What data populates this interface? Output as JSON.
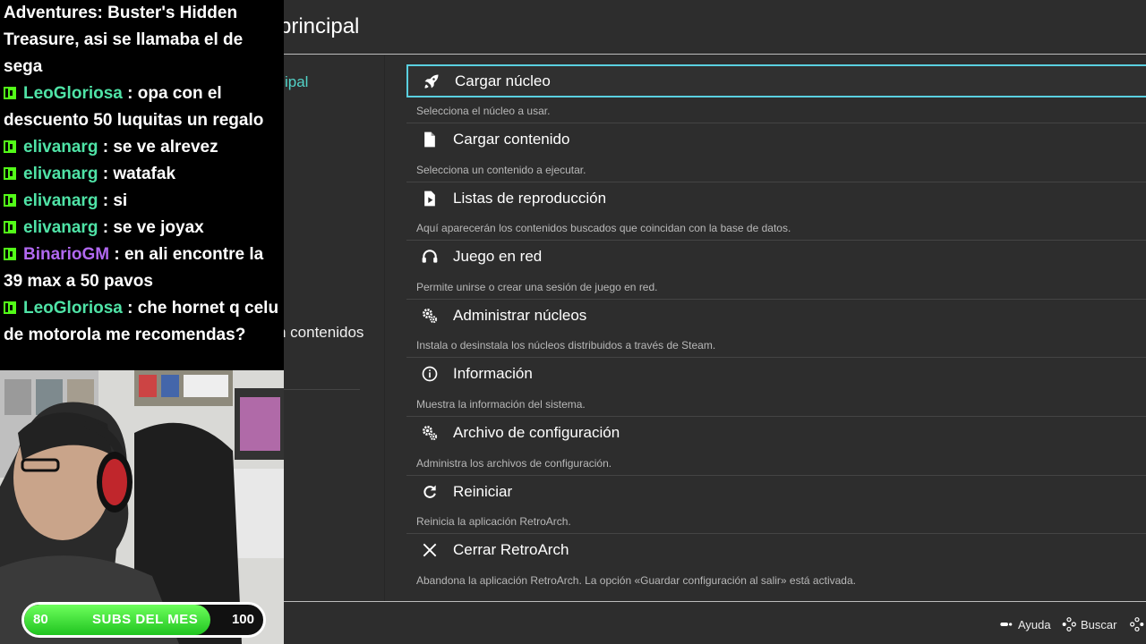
{
  "retroarch": {
    "title": "Menú principal",
    "title_visible": "principal",
    "sidebar": {
      "main_label_visible": "ipal",
      "contents_label_visible": "n contenidos"
    },
    "menu": [
      {
        "label": "Cargar núcleo",
        "sublabel": "Selecciona el núcleo a usar.",
        "icon": "rocket-icon"
      },
      {
        "label": "Cargar contenido",
        "sublabel": "Selecciona un contenido a ejecutar.",
        "icon": "file-icon"
      },
      {
        "label": "Listas de reproducción",
        "sublabel": "Aquí aparecerán los contenidos buscados que coincidan con la base de datos.",
        "icon": "playlist-icon"
      },
      {
        "label": "Juego en red",
        "sublabel": "Permite unirse o crear una sesión de juego en red.",
        "icon": "headset-icon"
      },
      {
        "label": "Administrar núcleos",
        "sublabel": "Instala o desinstala los núcleos distribuidos a través de Steam.",
        "icon": "gears-icon"
      },
      {
        "label": "Información",
        "sublabel": "Muestra la información del sistema.",
        "icon": "info-icon"
      },
      {
        "label": "Archivo de configuración",
        "sublabel": "Administra los archivos de configuración.",
        "icon": "gears-icon"
      },
      {
        "label": "Reiniciar",
        "sublabel": "Reinicia la aplicación RetroArch.",
        "icon": "restart-icon"
      },
      {
        "label": "Cerrar RetroArch",
        "sublabel": "Abandona la aplicación RetroArch. La opción «Guardar configuración al salir» está activada.",
        "icon": "close-icon"
      }
    ],
    "footer": {
      "help_label": "Ayuda",
      "search_label": "Buscar"
    },
    "colors": {
      "background": "#2d2d2d",
      "selection_border": "#5ad0e0",
      "sidebar_active": "#52d3c8"
    }
  },
  "chat": {
    "messages": [
      {
        "user": "",
        "text": "Adventures: Buster's Hidden Treasure, asi se llamaba el de sega"
      },
      {
        "user": "LeoGloriosa",
        "text": " : opa con el descuento 50 luquitas un regalo"
      },
      {
        "user": "elivanarg",
        "text": " : se ve alrevez"
      },
      {
        "user": "elivanarg",
        "text": " : watafak"
      },
      {
        "user": "elivanarg",
        "text": " : si"
      },
      {
        "user": "elivanarg",
        "text": " : se ve joyax"
      },
      {
        "user": "BinarioGM",
        "text": " : en ali encontre la 39 max a 50 pavos"
      },
      {
        "user": "LeoGloriosa",
        "text": " : che hornet q celu de motorola me recomendas?"
      }
    ]
  },
  "subs_goal": {
    "label": "SUBS DEL MES",
    "min": "80",
    "max": "100",
    "progress_fraction": 0.78
  }
}
